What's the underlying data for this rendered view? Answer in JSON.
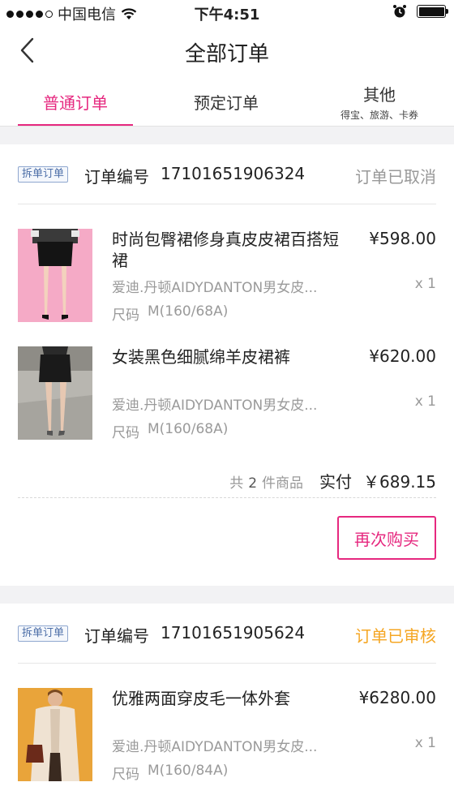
{
  "status_bar": {
    "carrier": "中国电信",
    "time": "下午4:51"
  },
  "nav": {
    "title": "全部订单"
  },
  "tabs": [
    {
      "label": "普通订单",
      "sub": ""
    },
    {
      "label": "预定订单",
      "sub": ""
    },
    {
      "label": "其他",
      "sub": "得宝、旅游、卡券"
    }
  ],
  "colors": {
    "accent": "#e6287f",
    "status_cancelled": "#999999",
    "status_reviewed": "#f5a623"
  },
  "orders": [
    {
      "badge": "拆单订单",
      "order_no_label": "订单编号",
      "order_no": "17101651906324",
      "status": "订单已取消",
      "items": [
        {
          "title": "时尚包臀裙修身真皮皮裙百搭短裙",
          "price": "¥598.00",
          "shop": "爱迪.丹顿AIDYDANTON男女皮...",
          "qty": "x 1",
          "size_label": "尺码",
          "size": "M(160/68A)"
        },
        {
          "title": "女装黑色细腻绵羊皮裙裤",
          "price": "¥620.00",
          "shop": "爱迪.丹顿AIDYDANTON男女皮...",
          "qty": "x 1",
          "size_label": "尺码",
          "size": "M(160/68A)"
        }
      ],
      "summary": {
        "pre": "共",
        "count": "2",
        "post": "件商品",
        "paid_label": "实付",
        "amount": "￥689.15"
      },
      "action": "再次购买"
    },
    {
      "badge": "拆单订单",
      "order_no_label": "订单编号",
      "order_no": "17101651905624",
      "status": "订单已审核",
      "items": [
        {
          "title": "优雅两面穿皮毛一体外套",
          "price": "¥6280.00",
          "shop": "爱迪.丹顿AIDYDANTON男女皮...",
          "qty": "x 1",
          "size_label": "尺码",
          "size": "M(160/84A)"
        }
      ]
    }
  ]
}
